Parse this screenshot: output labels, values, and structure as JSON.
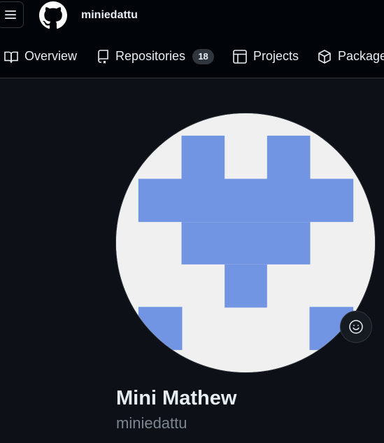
{
  "header": {
    "menu_icon": "hamburger-icon",
    "logo_icon": "github-octocat-icon",
    "username": "miniedattu"
  },
  "nav": {
    "tabs": [
      {
        "label": "Overview",
        "icon": "book-icon"
      },
      {
        "label": "Repositories",
        "icon": "repo-icon",
        "count": "18"
      },
      {
        "label": "Projects",
        "icon": "table-icon"
      },
      {
        "label": "Packages",
        "icon": "package-icon"
      }
    ]
  },
  "profile": {
    "full_name": "Mini Mathew",
    "login": "miniedattu",
    "status_icon": "smiley-icon",
    "avatar_color": "#7295e3",
    "avatar_bg": "#f0f0f0"
  }
}
